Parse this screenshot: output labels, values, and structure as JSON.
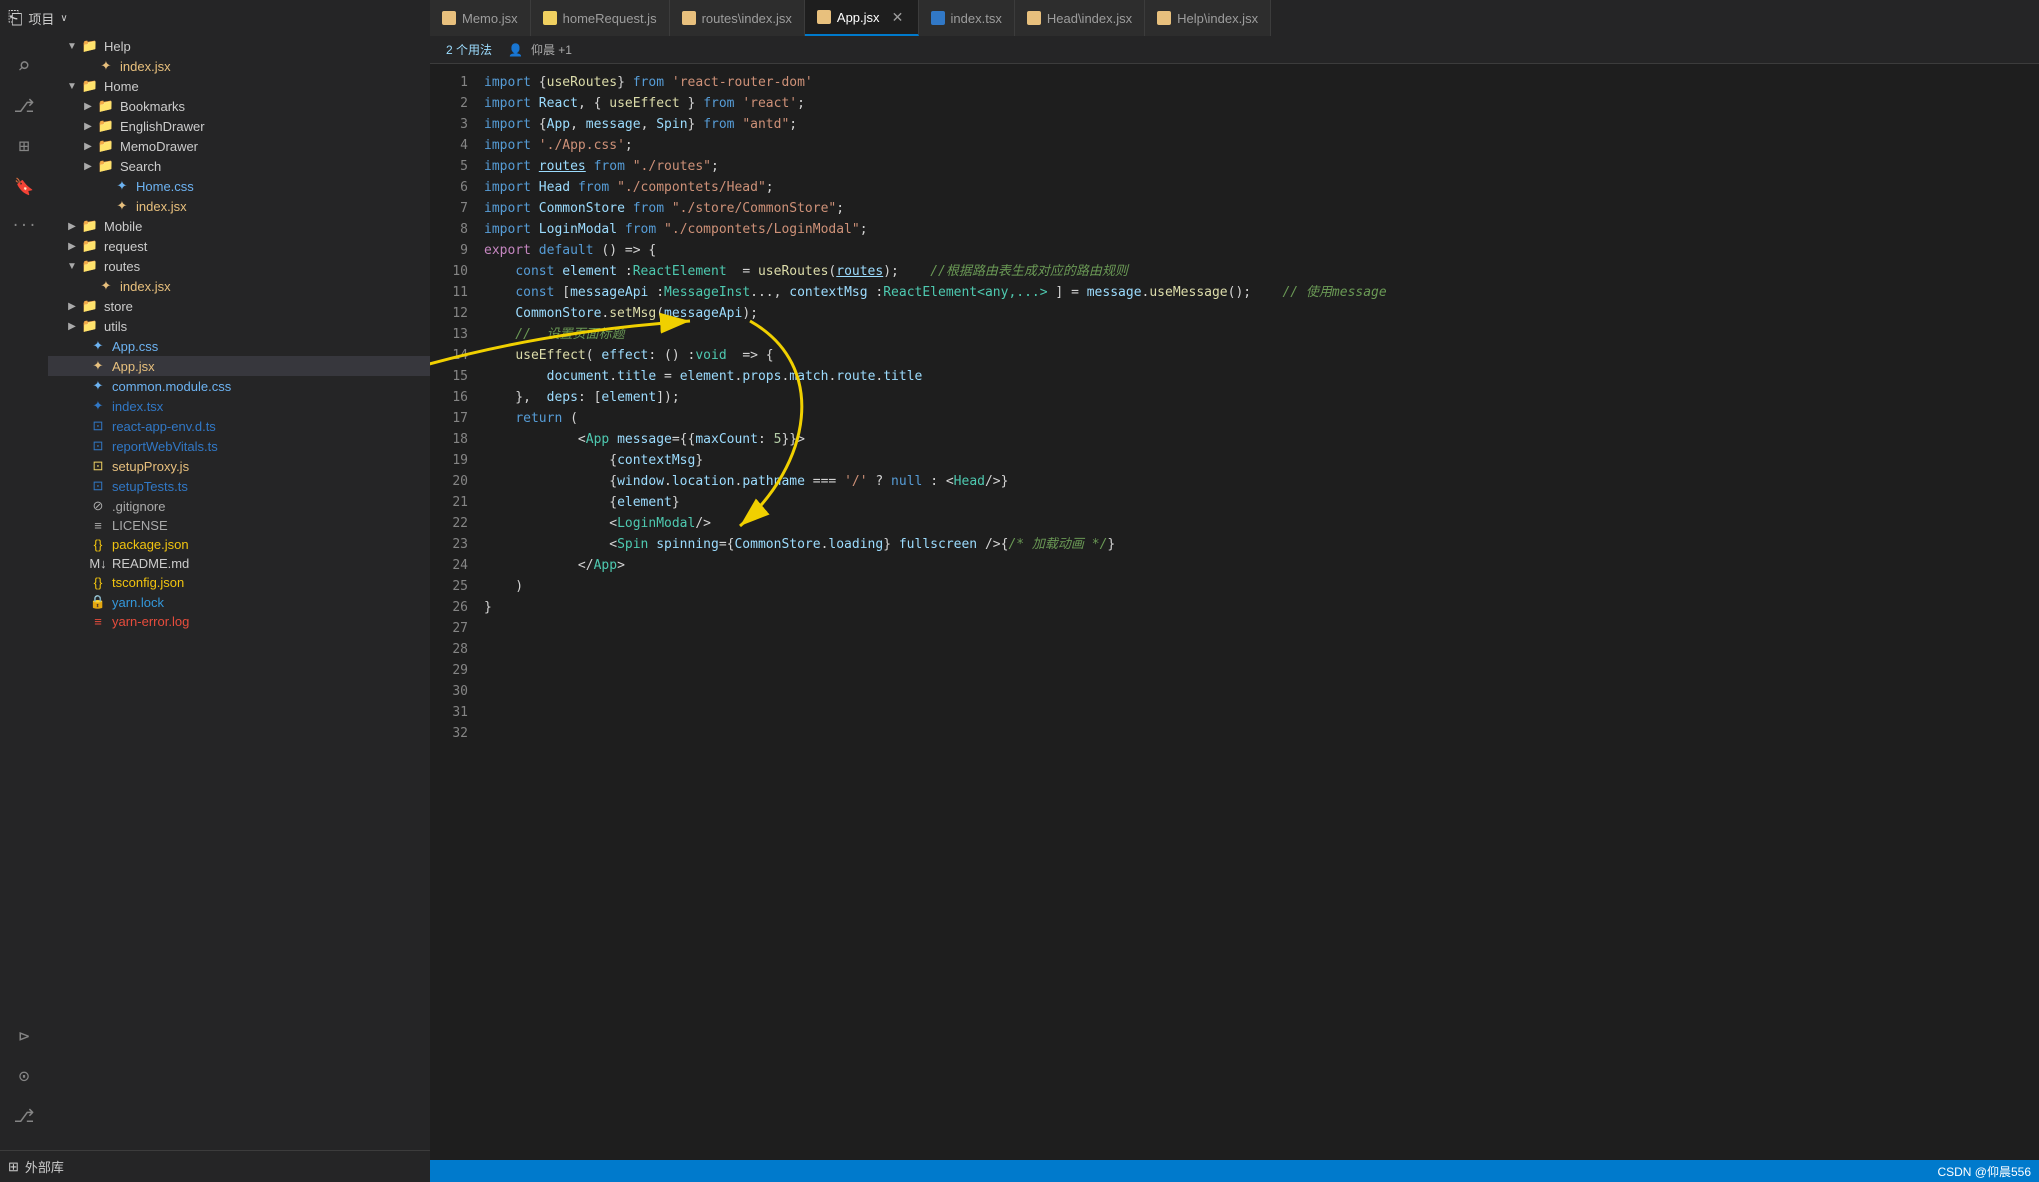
{
  "topBar": {
    "projectLabel": "项目",
    "chevron": "∨"
  },
  "activityBar": {
    "icons": [
      {
        "name": "files-icon",
        "symbol": "⎘",
        "active": false
      },
      {
        "name": "search-icon",
        "symbol": "⌕",
        "active": false
      },
      {
        "name": "source-control-icon",
        "symbol": "⎇",
        "active": false
      },
      {
        "name": "extensions-icon",
        "symbol": "⊞",
        "active": false
      },
      {
        "name": "bookmark-icon",
        "symbol": "🔖",
        "active": false
      },
      {
        "name": "more-icon",
        "symbol": "···",
        "active": false
      }
    ],
    "bottomIcons": [
      {
        "name": "remote-icon",
        "symbol": "⊳"
      },
      {
        "name": "account-icon",
        "symbol": "⊙"
      },
      {
        "name": "git-icon",
        "symbol": "⎇"
      },
      {
        "name": "settings-icon",
        "symbol": "⚙"
      }
    ]
  },
  "sidebar": {
    "items": [
      {
        "id": "help",
        "label": "Help",
        "type": "folder",
        "indent": 1,
        "open": true,
        "arrow": "▼"
      },
      {
        "id": "help-index",
        "label": "index.jsx",
        "type": "file-jsx",
        "indent": 2,
        "arrow": ""
      },
      {
        "id": "home",
        "label": "Home",
        "type": "folder",
        "indent": 1,
        "open": true,
        "arrow": "▼"
      },
      {
        "id": "bookmarks",
        "label": "Bookmarks",
        "type": "folder",
        "indent": 2,
        "open": false,
        "arrow": "▶"
      },
      {
        "id": "englishdrawer",
        "label": "EnglishDrawer",
        "type": "folder",
        "indent": 2,
        "open": false,
        "arrow": "▶"
      },
      {
        "id": "memodrawer",
        "label": "MemoDrawer",
        "type": "folder",
        "indent": 2,
        "open": false,
        "arrow": "▶"
      },
      {
        "id": "search",
        "label": "Search",
        "type": "folder",
        "indent": 2,
        "open": false,
        "arrow": "▶"
      },
      {
        "id": "home-css",
        "label": "Home.css",
        "type": "file-css",
        "indent": 3,
        "arrow": ""
      },
      {
        "id": "home-index",
        "label": "index.jsx",
        "type": "file-jsx",
        "indent": 3,
        "arrow": ""
      },
      {
        "id": "mobile",
        "label": "Mobile",
        "type": "folder",
        "indent": 1,
        "open": false,
        "arrow": "▶"
      },
      {
        "id": "request",
        "label": "request",
        "type": "folder",
        "indent": 1,
        "open": false,
        "arrow": "▶"
      },
      {
        "id": "routes",
        "label": "routes",
        "type": "folder",
        "indent": 1,
        "open": true,
        "arrow": "▼"
      },
      {
        "id": "routes-index",
        "label": "index.jsx",
        "type": "file-jsx",
        "indent": 2,
        "arrow": ""
      },
      {
        "id": "store",
        "label": "store",
        "type": "folder",
        "indent": 1,
        "open": false,
        "arrow": "▶"
      },
      {
        "id": "utils",
        "label": "utils",
        "type": "folder",
        "indent": 1,
        "open": false,
        "arrow": "▶"
      },
      {
        "id": "appcss",
        "label": "App.css",
        "type": "file-css",
        "indent": 1,
        "arrow": ""
      },
      {
        "id": "appjsx",
        "label": "App.jsx",
        "type": "file-jsx",
        "indent": 1,
        "arrow": "",
        "selected": true
      },
      {
        "id": "common-css",
        "label": "common.module.css",
        "type": "file-css",
        "indent": 1,
        "arrow": ""
      },
      {
        "id": "index-tsx",
        "label": "index.tsx",
        "type": "file-tsx",
        "indent": 1,
        "arrow": ""
      },
      {
        "id": "react-app-env",
        "label": "react-app-env.d.ts",
        "type": "file-ts",
        "indent": 1,
        "arrow": ""
      },
      {
        "id": "reportwebvitals",
        "label": "reportWebVitals.ts",
        "type": "file-ts",
        "indent": 1,
        "arrow": ""
      },
      {
        "id": "setupproxy",
        "label": "setupProxy.js",
        "type": "file-js",
        "indent": 1,
        "arrow": ""
      },
      {
        "id": "setuptests",
        "label": "setupTests.ts",
        "type": "file-ts",
        "indent": 1,
        "arrow": ""
      },
      {
        "id": "gitignore",
        "label": ".gitignore",
        "type": "file-ignore",
        "indent": 1,
        "arrow": ""
      },
      {
        "id": "license",
        "label": "LICENSE",
        "type": "file-ignore",
        "indent": 1,
        "arrow": ""
      },
      {
        "id": "package-json",
        "label": "package.json",
        "type": "file-json",
        "indent": 1,
        "arrow": ""
      },
      {
        "id": "readme",
        "label": "README.md",
        "type": "file-md",
        "indent": 1,
        "arrow": ""
      },
      {
        "id": "tsconfig",
        "label": "tsconfig.json",
        "type": "file-json",
        "indent": 1,
        "arrow": ""
      },
      {
        "id": "yarn-lock",
        "label": "yarn.lock",
        "type": "file-lock",
        "indent": 1,
        "arrow": ""
      },
      {
        "id": "yarn-error",
        "label": "yarn-error.log",
        "type": "file-log",
        "indent": 1,
        "arrow": ""
      }
    ],
    "bottomLabel": "外部库"
  },
  "tabs": [
    {
      "id": "memo",
      "label": "Memo.jsx",
      "type": "jsx",
      "active": false
    },
    {
      "id": "homerequest",
      "label": "homeRequest.js",
      "type": "js",
      "active": false
    },
    {
      "id": "routesindex",
      "label": "routes\\index.jsx",
      "type": "jsx",
      "active": false
    },
    {
      "id": "appjsx",
      "label": "App.jsx",
      "type": "jsx",
      "active": true,
      "closeable": true
    },
    {
      "id": "indextsx",
      "label": "index.tsx",
      "type": "tsx",
      "active": false
    },
    {
      "id": "headindex",
      "label": "Head\\index.jsx",
      "type": "jsx",
      "active": false
    },
    {
      "id": "helpindex",
      "label": "Help\\index.jsx",
      "type": "jsx",
      "active": false
    }
  ],
  "codeInfo": {
    "usages": "2 个用法",
    "author": "仰晨 +1"
  },
  "codeLines": [
    {
      "num": 1,
      "code": "import_kw_import",
      "text": "import {useRoutes} from 'react-router-dom'"
    },
    {
      "num": 2,
      "text": "import React, { useEffect } from 'react';"
    },
    {
      "num": 3,
      "text": "import {App, message, Spin} from \"antd\";"
    },
    {
      "num": 4,
      "text": ""
    },
    {
      "num": 5,
      "text": "import './App.css';"
    },
    {
      "num": 6,
      "text": "import routes from \"./routes\";"
    },
    {
      "num": 7,
      "text": "import Head from \"./compontets/Head\";"
    },
    {
      "num": 8,
      "text": "import CommonStore from \"./store/CommonStore\";"
    },
    {
      "num": 9,
      "text": "import LoginModal from \"./compontets/LoginModal\";"
    },
    {
      "num": 10,
      "text": ""
    },
    {
      "num": 11,
      "text": "export default () => {"
    },
    {
      "num": 12,
      "text": "    const element :ReactElement  = useRoutes(routes);    //根据路由表生成对应的路由规则"
    },
    {
      "num": 13,
      "text": "    const [messageApi :MessageInstance, contextMsg :ReactElement<any,...> ] = message.useMessage();    // 使用message"
    },
    {
      "num": 14,
      "text": ""
    },
    {
      "num": 15,
      "text": ""
    },
    {
      "num": 16,
      "text": "    CommonStore.setMsg(messageApi);"
    },
    {
      "num": 17,
      "text": ""
    },
    {
      "num": 18,
      "text": "    //  设置页面标题"
    },
    {
      "num": 19,
      "text": "    useEffect( effect: () :void  => {"
    },
    {
      "num": 20,
      "text": "        document.title = element.props.match.route.title"
    },
    {
      "num": 21,
      "text": "    },  deps: [element]);"
    },
    {
      "num": 22,
      "text": ""
    },
    {
      "num": 23,
      "text": "    return ("
    },
    {
      "num": 24,
      "text": "            <App message={{maxCount: 5}}>"
    },
    {
      "num": 25,
      "text": "                {contextMsg}"
    },
    {
      "num": 26,
      "text": "                {window.location.pathname === '/' ? null : <Head/>}"
    },
    {
      "num": 27,
      "text": "                {element}"
    },
    {
      "num": 28,
      "text": "                <LoginModal/>"
    },
    {
      "num": 29,
      "text": "                <Spin spinning={CommonStore.loading} fullscreen />{/* 加载动画 */}"
    },
    {
      "num": 30,
      "text": "            </App>"
    },
    {
      "num": 31,
      "text": "    )"
    },
    {
      "num": 32,
      "text": "}"
    }
  ],
  "statusBar": {
    "rightText": "CSDN @仰晨556"
  }
}
